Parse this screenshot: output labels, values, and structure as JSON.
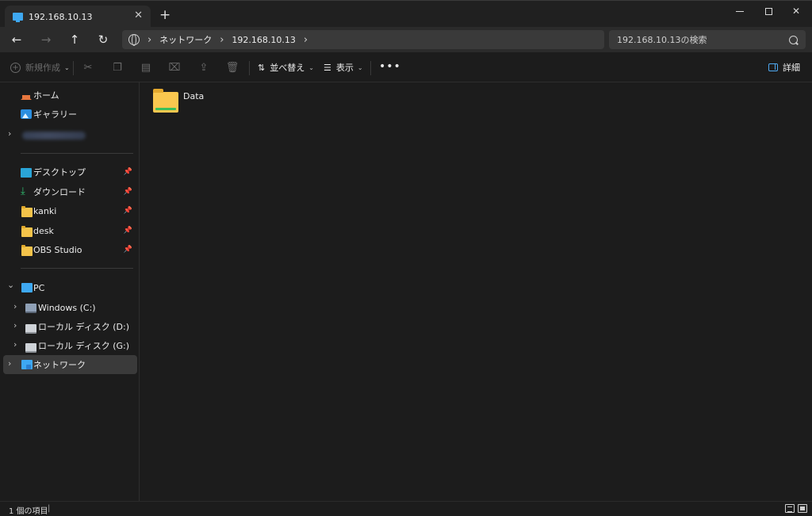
{
  "window": {
    "tab_title": "192.168.10.13",
    "tab_close": "✕",
    "new_tab": "+",
    "minimize": "—",
    "close": "✕"
  },
  "navigation": {
    "back": "←",
    "forward": "→",
    "up": "↑",
    "refresh": "↻",
    "breadcrumb": [
      "ネットワーク",
      "192.168.10.13"
    ],
    "separator": "›",
    "search_placeholder": "192.168.10.13の検索"
  },
  "commands": {
    "new_label": "新規作成",
    "sort_label": "並べ替え",
    "view_label": "表示",
    "more": "•••",
    "details_label": "詳細",
    "icons": [
      "cut-icon",
      "copy-icon",
      "paste-icon",
      "rename-icon",
      "share-icon",
      "delete-icon"
    ]
  },
  "sidebar": {
    "items": [
      {
        "label": "ホーム",
        "icon": "home-icon"
      },
      {
        "label": "ギャラリー",
        "icon": "gallery-icon"
      },
      {
        "label": "デスクトップ",
        "icon": "desktop-icon",
        "pinned": true
      },
      {
        "label": "ダウンロード",
        "icon": "download-icon",
        "pinned": true
      },
      {
        "label": "kanki",
        "icon": "folder-icon",
        "pinned": true
      },
      {
        "label": "desk",
        "icon": "folder-icon",
        "pinned": true
      },
      {
        "label": "OBS Studio",
        "icon": "folder-icon",
        "pinned": true
      },
      {
        "label": "PC",
        "icon": "pc-icon",
        "expanded": true
      },
      {
        "label": "Windows (C:)",
        "icon": "drive-icon"
      },
      {
        "label": "ローカル ディスク (D:)",
        "icon": "drive-icon"
      },
      {
        "label": "ローカル ディスク (G:)",
        "icon": "drive-icon"
      },
      {
        "label": "ネットワーク",
        "icon": "network-icon",
        "selected": true
      }
    ],
    "expand_glyph": "›",
    "collapse_glyph": "⌄",
    "pin_glyph": "📌"
  },
  "content": {
    "files": [
      {
        "name": "Data",
        "type": "folder"
      }
    ]
  },
  "status": {
    "item_count": "1 個の項目",
    "separator": "|"
  },
  "colors": {
    "background": "#1c1c1c",
    "toolbar": "#2b2b2b",
    "accent": "#3ea8f2",
    "folder": "#f9c74f",
    "selected": "#3a3a3a"
  }
}
